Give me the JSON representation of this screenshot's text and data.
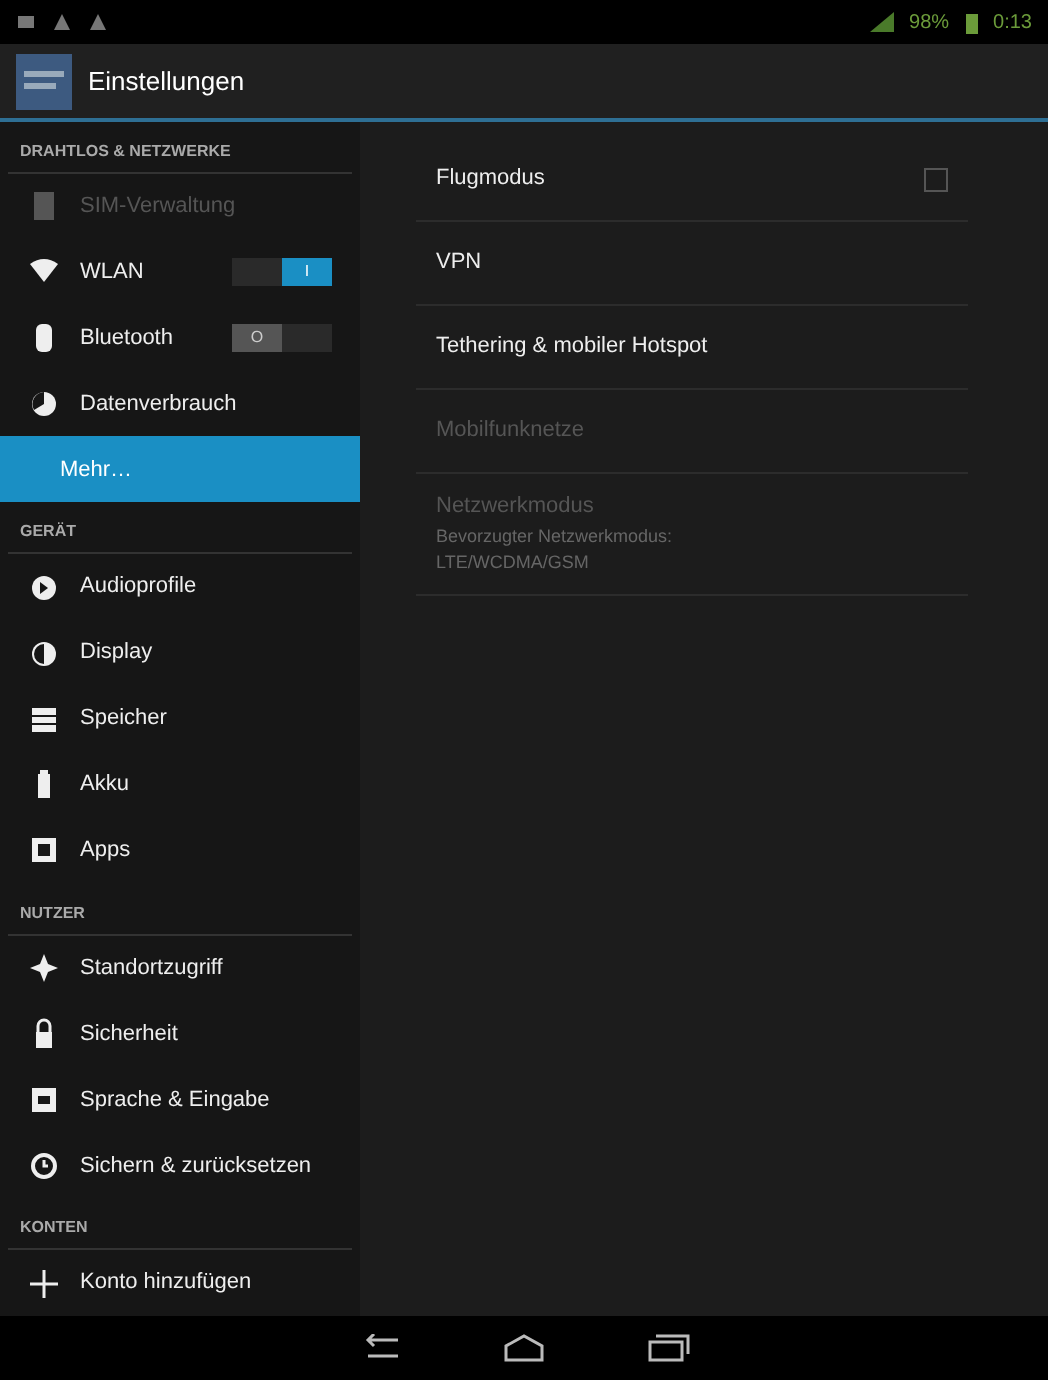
{
  "status_bar": {
    "battery": "98%",
    "time": "0:13"
  },
  "action_bar": {
    "title": "Einstellungen"
  },
  "sidebar": [
    {
      "kind": "header",
      "label": "DRAHTLOS & NETZWERKE"
    },
    {
      "kind": "item",
      "label": "SIM-Verwaltung",
      "disabled": true,
      "selected": false
    },
    {
      "kind": "toggle",
      "label": "WLAN",
      "on": true,
      "switch_text": "I",
      "selected": false
    },
    {
      "kind": "toggle",
      "label": "Bluetooth",
      "on": false,
      "switch_text": "O",
      "selected": false
    },
    {
      "kind": "item",
      "label": "Datenverbrauch",
      "disabled": false,
      "selected": false
    },
    {
      "kind": "item",
      "label": "Mehr…",
      "disabled": false,
      "selected": true
    },
    {
      "kind": "header",
      "label": "GERÄT"
    },
    {
      "kind": "item",
      "label": "Audioprofile",
      "disabled": false,
      "selected": false
    },
    {
      "kind": "item",
      "label": "Display",
      "disabled": false,
      "selected": false
    },
    {
      "kind": "item",
      "label": "Speicher",
      "disabled": false,
      "selected": false
    },
    {
      "kind": "item",
      "label": "Akku",
      "disabled": false,
      "selected": false
    },
    {
      "kind": "item",
      "label": "Apps",
      "disabled": false,
      "selected": false
    },
    {
      "kind": "header",
      "label": "NUTZER"
    },
    {
      "kind": "item",
      "label": "Standortzugriff",
      "disabled": false,
      "selected": false
    },
    {
      "kind": "item",
      "label": "Sicherheit",
      "disabled": false,
      "selected": false
    },
    {
      "kind": "item",
      "label": "Sprache & Eingabe",
      "disabled": false,
      "selected": false
    },
    {
      "kind": "item",
      "label": "Sichern & zurücksetzen",
      "disabled": false,
      "selected": false
    },
    {
      "kind": "header",
      "label": "KONTEN"
    },
    {
      "kind": "item",
      "label": "Konto hinzufügen",
      "disabled": false,
      "selected": false
    }
  ],
  "content": [
    {
      "kind": "check",
      "label": "Flugmodus",
      "checked": false,
      "disabled": false
    },
    {
      "kind": "plain",
      "label": "VPN",
      "disabled": false
    },
    {
      "kind": "plain",
      "label": "Tethering & mobiler Hotspot",
      "disabled": false
    },
    {
      "kind": "plain",
      "label": "Mobilfunknetze",
      "disabled": true
    },
    {
      "kind": "summary",
      "label": "Netzwerkmodus",
      "summary": "Bevorzugter Netzwerkmodus: LTE/WCDMA/GSM",
      "disabled": true
    }
  ]
}
